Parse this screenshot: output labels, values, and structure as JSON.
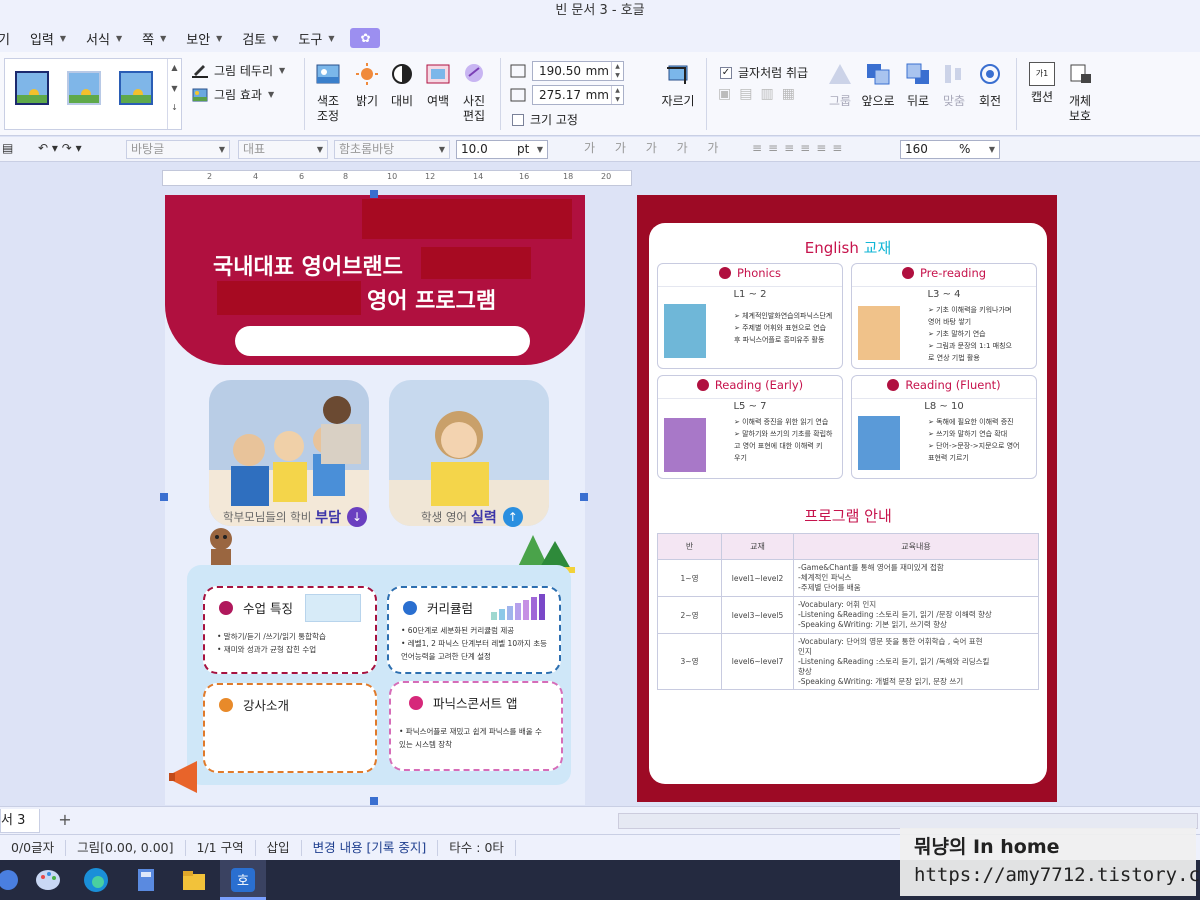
{
  "window": {
    "title": "빈 문서 3 - 호글"
  },
  "menu": {
    "items": [
      "기",
      "입력",
      "서식",
      "쪽",
      "보안",
      "검토",
      "도구"
    ]
  },
  "ribbon": {
    "border_label": "그림 테두리",
    "effect_label": "그림 효과",
    "color_adjust": "색조\n조정",
    "brightness": "밝기",
    "contrast": "대비",
    "margin": "여백",
    "photo_edit": "사진\n편집",
    "width_value": "190.50",
    "height_value": "275.17",
    "unit": "mm",
    "crop": "자르기",
    "treat_as_char": "글자처럼 취급",
    "fix_size": "크기 고정",
    "group": "그룹",
    "bring_front": "앞으로",
    "send_back": "뒤로",
    "align": "맞춤",
    "rotate": "회전",
    "caption": "캡션",
    "object_protect": "개체\n보호",
    "caption_icon": "가1"
  },
  "format_bar": {
    "style": "바탕글",
    "representative": "대표",
    "font": "함초롬바탕",
    "size": "10.0",
    "size_unit": "pt",
    "zoom": "160",
    "zoom_unit": "%"
  },
  "ruler": {
    "ticks": [
      "2",
      "4",
      "6",
      "8",
      "10",
      "12",
      "14",
      "16",
      "18",
      "20"
    ]
  },
  "page1": {
    "headline1": "국내대표 영어브랜드",
    "headline2": "영어 프로그램",
    "caption_left_pre": "학부모님들의 학비",
    "caption_left_em": "부담",
    "caption_right_pre": "학생 영어",
    "caption_right_em": "실력",
    "cards": [
      {
        "title": "수업 특징",
        "lines": [
          "• 말하기/듣기 /쓰기/읽기 통합학습",
          "• 재미와 성과가 균형 잡힌 수업"
        ]
      },
      {
        "title": "커리큘럼",
        "lines": [
          "• 60단계로 세분화된 커리큘럼 제공",
          "• 레벨1, 2 파닉스 단계부터 레벨 10까지 초등",
          "  언어능력을 고려한 단계 설정"
        ]
      },
      {
        "title": "강사소개",
        "lines": []
      },
      {
        "title": "파닉스콘서트 앱",
        "lines": [
          "• 파닉스어플로 재밌고 쉽게 파닉스를 배울 수",
          "  있는 시스템 장착"
        ]
      }
    ]
  },
  "page2": {
    "title_main": "English",
    "title_accent": "교재",
    "levels": [
      {
        "name": "Phonics",
        "range": "L1 ~ 2",
        "lines": [
          "➢ 체계적인발화연습의파닉스단계",
          "➢ 주제별 어휘와 표현으로 연습",
          "  후 파닉스어플로 흥미유주 활동"
        ]
      },
      {
        "name": "Pre-reading",
        "range": "L3 ~ 4",
        "lines": [
          "➢ 기초 이해력을 키워나가며",
          "  영어 바탕 쌓기",
          "➢ 기초 말하기 연습",
          "➢ 그림과 문장의 1:1 매칭으",
          "  로 연상 기법 활용"
        ]
      },
      {
        "name": "Reading (Early)",
        "range": "L5 ~ 7",
        "lines": [
          "➢ 이해력 증진을 위한 읽기 연습",
          "➢ 말하기와 쓰기의 기초를 확립하",
          "  고 영어 표현에 대한 이해력 키",
          "  우기"
        ]
      },
      {
        "name": "Reading (Fluent)",
        "range": "L8 ~ 10",
        "lines": [
          "➢ 독해에 필요한 이해력 증진",
          "➢ 쓰기와 말하기 연습 확대",
          "➢ 단어->문장->지문으로 영어",
          "  표현력 기르기"
        ]
      }
    ],
    "program_title": "프로그램 안내",
    "table": {
      "headers": [
        "반",
        "교재",
        "교육내용"
      ],
      "rows": [
        {
          "class": "1~영",
          "book": "level1~level2",
          "content": [
            "-Game&Chant를 통해 영어를 재미있게 접함",
            "-체계적인 파닉스",
            "-주제별 단어를 배움"
          ]
        },
        {
          "class": "2~영",
          "book": "level3~level5",
          "content": [
            "-Vocabulary: 어휘 인지",
            "-Listening &Reading :스토리 듣기, 읽기 /문장 이해력 향상",
            "-Speaking &Writing: 기본 읽기, 쓰기력 향상"
          ]
        },
        {
          "class": "3~영",
          "book": "level6~level7",
          "content": [
            "-Vocabulary: 단어의 영문 뜻을 통한 어휘학습 , 숙어 표현",
            "  인지",
            "-Listening &Reading :스토리 듣기, 읽기 /독해와 리딩스킬",
            "  향상",
            "-Speaking &Writing: 개별적 문장 읽기, 문장 쓰기"
          ]
        }
      ]
    }
  },
  "tabs": {
    "active": "서 3",
    "add": "+"
  },
  "status": {
    "chars": "0/0글자",
    "picture": "그림[0.00, 0.00]",
    "section": "1/1 구역",
    "mode": "삽입",
    "track": "변경 내용 [기록 중지]",
    "strokes": "타수 : 0타"
  },
  "watermark": {
    "line1": "뭐냥의 In home",
    "line2": "https://amy7712.tistory.com"
  },
  "colors": {
    "accent": "#b0103f",
    "ribbon_bg": "#f7f8fd",
    "doc_bg": "#dde3f6"
  }
}
